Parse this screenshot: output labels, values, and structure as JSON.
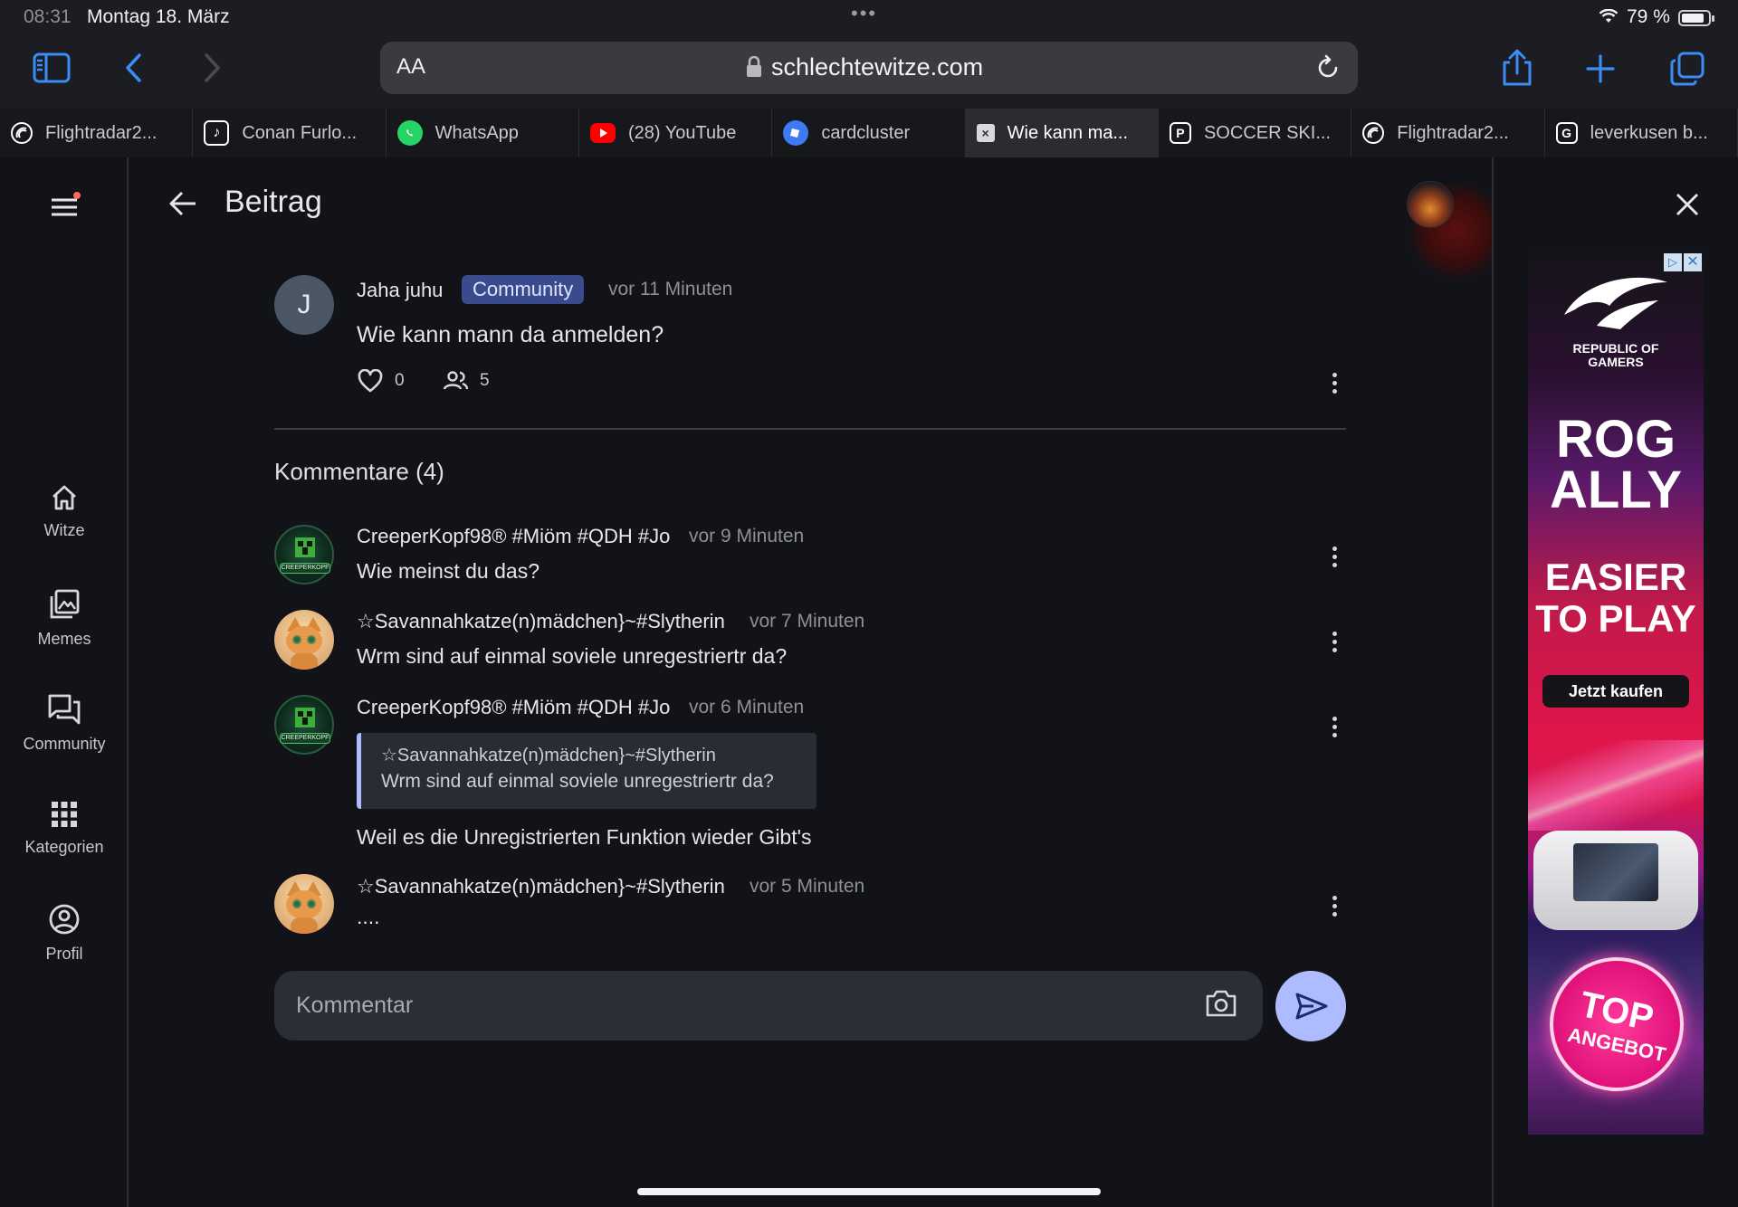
{
  "status_bar": {
    "time": "08:31",
    "date": "Montag 18. März",
    "battery": "79 %"
  },
  "browser": {
    "reader_label": "AA",
    "url": "schlechtewitze.com",
    "tabs": [
      {
        "label": "Flightradar2...",
        "icon": "flightradar-icon",
        "color": "#ffffff"
      },
      {
        "label": "Conan Furlo...",
        "icon": "tiktok-icon",
        "color": "#ffffff"
      },
      {
        "label": "WhatsApp",
        "icon": "whatsapp-icon",
        "color": "#25d366"
      },
      {
        "label": "(28) YouTube",
        "icon": "youtube-icon",
        "color": "#ff0000"
      },
      {
        "label": "cardcluster",
        "icon": "cardcluster-icon",
        "color": "#3d7bf5"
      },
      {
        "label": "Wie kann ma...",
        "icon": "x-icon",
        "color": "#cfcfcf",
        "active": true
      },
      {
        "label": "SOCCER SKI...",
        "icon": "p-icon",
        "color": "#ffffff"
      },
      {
        "label": "Flightradar2...",
        "icon": "flightradar-icon",
        "color": "#ffffff"
      },
      {
        "label": "leverkusen b...",
        "icon": "google-icon",
        "color": "#ffffff"
      }
    ]
  },
  "nav": {
    "items": [
      {
        "label": "Witze",
        "icon": "home-icon"
      },
      {
        "label": "Memes",
        "icon": "gallery-icon"
      },
      {
        "label": "Community",
        "icon": "forum-icon"
      },
      {
        "label": "Kategorien",
        "icon": "grid-icon"
      },
      {
        "label": "Profil",
        "icon": "account-icon"
      }
    ]
  },
  "header": {
    "title": "Beitrag"
  },
  "post": {
    "avatar_letter": "J",
    "author": "Jaha juhu",
    "badge": "Community",
    "time": "vor 11 Minuten",
    "text": "Wie kann mann da anmelden?",
    "likes": "0",
    "participants": "5"
  },
  "comments_heading": "Kommentare (4)",
  "comments": [
    {
      "author": "CreeperKopf98® #Miöm #QDH #Jo",
      "time": "vor 9 Minuten",
      "text": "Wie meinst du das?",
      "avatar": "creeper"
    },
    {
      "author": "☆Savannahkatze(n)mädchen}~#Slytherin",
      "time": "vor 7 Minuten",
      "text": "Wrm sind auf einmal soviele unregestriertr da?",
      "avatar": "cat"
    },
    {
      "author": "CreeperKopf98® #Miöm #QDH #Jo",
      "time": "vor 6 Minuten",
      "quote_author": "☆Savannahkatze(n)mädchen}~#Slytherin",
      "quote_text": "Wrm sind auf einmal soviele unregestriertr da?",
      "text": "Weil es die Unregistrierten Funktion wieder Gibt's",
      "avatar": "creeper"
    },
    {
      "author": "☆Savannahkatze(n)mädchen}~#Slytherin",
      "time": "vor 5 Minuten",
      "text": "....",
      "avatar": "cat"
    }
  ],
  "comment_input": {
    "placeholder": "Kommentar"
  },
  "creeper_label": "CREEPERKOPF",
  "ad": {
    "brand_line1": "REPUBLIC OF",
    "brand_line2": "GAMERS",
    "headline1": "ROG",
    "headline2": "ALLY",
    "sub1": "EASIER",
    "sub2": "TO PLAY",
    "cta": "Jetzt kaufen",
    "badge1": "TOP",
    "badge2": "ANGEBOT"
  },
  "colors": {
    "accent": "#3d8bf5",
    "badge_bg": "#3a4a8c",
    "send": "#aebcff"
  }
}
